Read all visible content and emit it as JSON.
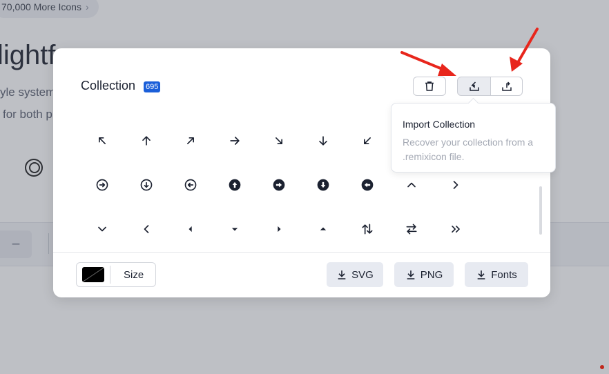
{
  "background": {
    "pill_label": "70,000 More Icons",
    "title_fragment": "lightf",
    "line1": "yle system",
    "line2": "for both p"
  },
  "modal": {
    "title": "Collection",
    "count_badge": "695",
    "toolbar": {
      "delete": "trash-icon",
      "import": "import-icon",
      "export": "export-icon"
    },
    "icons": [
      "arrow-left-up",
      "arrow-up",
      "arrow-right-up",
      "arrow-right",
      "arrow-right-down",
      "arrow-down",
      "arrow-left-down",
      "arrow-right-circle",
      "arrow-down-circle",
      "arrow-left-circle",
      "arrow-up-circle-fill",
      "arrow-right-circle-fill",
      "arrow-down-circle-fill",
      "arrow-left-circle-fill",
      "arrow-up-s",
      "arrow-right-s",
      "arrow-down-s",
      "arrow-left-s",
      "arrow-left-s-fill",
      "arrow-down-s-fill",
      "arrow-right-s-fill",
      "arrow-up-s-fill",
      "arrow-up-down",
      "arrow-left-right",
      "arrow-right-double"
    ],
    "size_label": "Size",
    "color_value": "#000000",
    "download_svg": "SVG",
    "download_png": "PNG",
    "download_fonts": "Fonts"
  },
  "tooltip": {
    "title": "Import Collection",
    "description": "Recover your collection from a .remixicon file."
  },
  "colors": {
    "accent_badge": "#1b5fd9",
    "annotation_arrow": "#e8261c"
  }
}
